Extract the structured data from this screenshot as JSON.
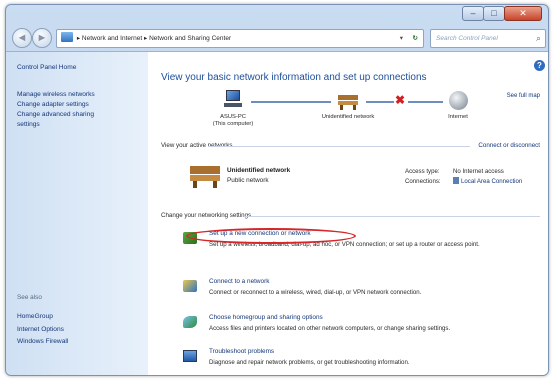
{
  "window": {
    "controls": {
      "minimize": "–",
      "maximize": "□",
      "close": "✕"
    }
  },
  "navbar": {
    "back": "◄",
    "forward": "►",
    "address": "▸ Network and Internet ▸ Network and Sharing Center",
    "search_placeholder": "Search Control Panel",
    "search_icon": "⌕",
    "dropdown_icon": "▾",
    "refresh_icon": "↻"
  },
  "sidebar": {
    "home": "Control Panel Home",
    "links": [
      "Manage wireless networks",
      "Change adapter settings",
      "Change advanced sharing",
      "settings"
    ],
    "see_also": "See also",
    "bottom_links": [
      "HomeGroup",
      "Internet Options",
      "Windows Firewall"
    ]
  },
  "main": {
    "help": "?",
    "heading": "View your basic network information and set up connections",
    "see_full_map": "See full map",
    "map": {
      "computer_name": "ASUS-PC",
      "computer_sub": "(This computer)",
      "network": "Unidentified network",
      "internet": "Internet",
      "broken_marker": "✖"
    },
    "active_networks_label": "View your active networks",
    "connect_disconnect": "Connect or disconnect",
    "active": {
      "name": "Unidentified network",
      "type": "Public network",
      "access_type_label": "Access type:",
      "access_type_value": "No Internet access",
      "connections_label": "Connections:",
      "connections_value": "Local Area Connection"
    },
    "change_settings_label": "Change your networking settings",
    "tasks": [
      {
        "link": "Set up a new connection or network",
        "desc": "Set up a wireless, broadband, dial-up, ad hoc, or VPN connection; or set up a router or access point."
      },
      {
        "link": "Connect to a network",
        "desc": "Connect or reconnect to a wireless, wired, dial-up, or VPN network connection."
      },
      {
        "link": "Choose homegroup and sharing options",
        "desc": "Access files and printers located on other network computers, or change sharing settings."
      },
      {
        "link": "Troubleshoot problems",
        "desc": "Diagnose and repair network problems, or get troubleshooting information."
      }
    ]
  },
  "colors": {
    "link": "#14377a",
    "heading": "#1d4f9b",
    "highlight": "#d6262a",
    "sidebar": "#cfe0f3"
  }
}
